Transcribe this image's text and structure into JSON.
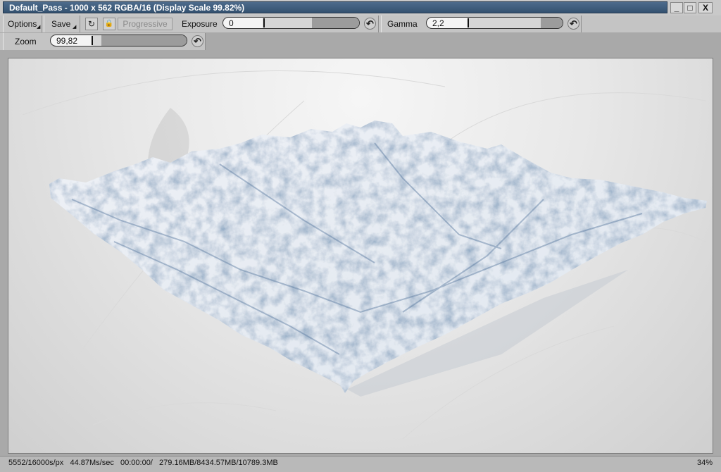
{
  "window": {
    "title": "Default_Pass -  1000 x 562 RGBA/16 (Display Scale 99.82%)",
    "minimize": "_",
    "maximize": "□",
    "close": "X"
  },
  "toolbar": {
    "options_label": "Options",
    "save_label": "Save",
    "progressive_label": "Progressive",
    "exposure_label": "Exposure",
    "exposure_value": "0",
    "gamma_label": "Gamma",
    "gamma_value": "2,2",
    "zoom_label": "Zoom",
    "zoom_value": "99,82"
  },
  "icons": {
    "refresh": "↻",
    "lock": "🔒",
    "reset": "↶"
  },
  "status": {
    "stats": "5552/16000s/px   44.87Ms/sec   00:00:00/   279.16MB/8434.57MB/10789.3MB",
    "percent": "34%"
  },
  "colors": {
    "titlebar": "#3f5d7e",
    "terrain_light": "#f2f4f8",
    "terrain_shadow": "#4a6a90"
  }
}
